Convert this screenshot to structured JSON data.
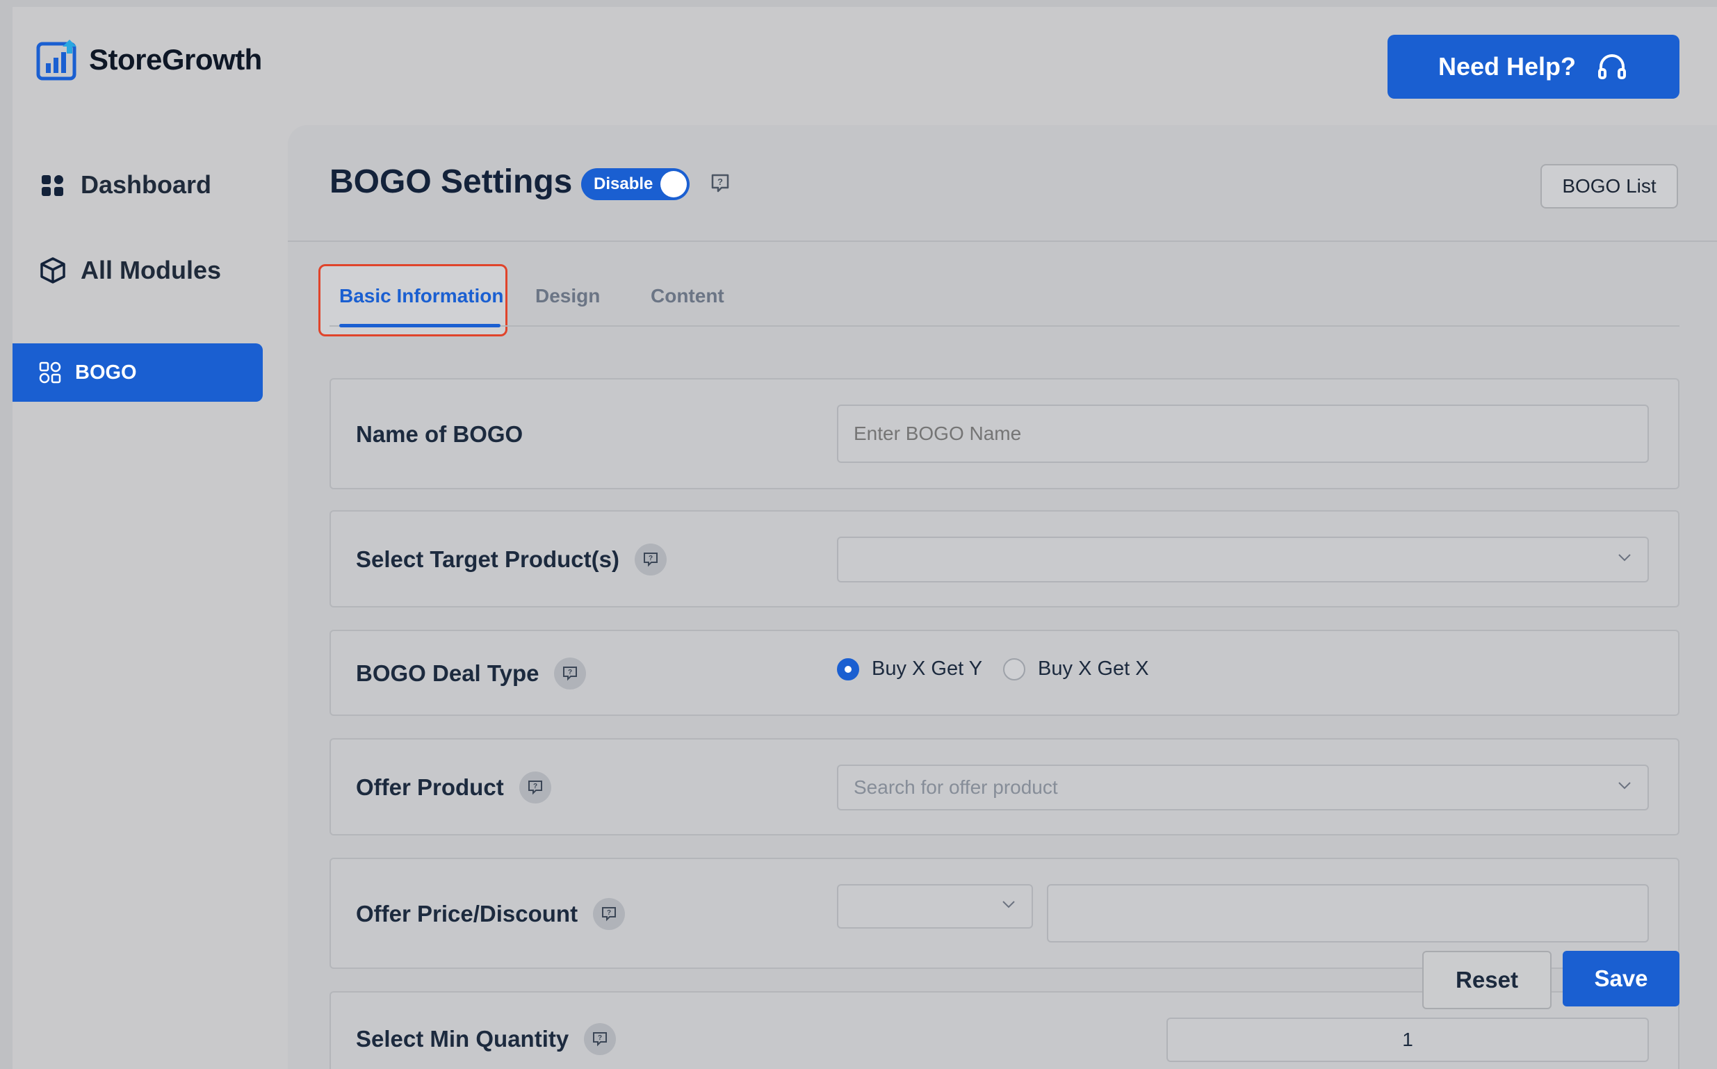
{
  "brand": {
    "name": "StoreGrowth",
    "logo_icon": "bar-chart-logo-icon"
  },
  "header": {
    "help_label": "Need Help?",
    "help_icon": "headset-icon"
  },
  "sidebar": {
    "items": [
      {
        "label": "Dashboard",
        "icon": "grid-icon"
      },
      {
        "label": "All Modules",
        "icon": "cube-icon"
      },
      {
        "label": "BOGO",
        "icon": "modules-icon",
        "active": true
      }
    ]
  },
  "page": {
    "title": "BOGO Settings",
    "toggle_label": "Disable",
    "list_button": "BOGO List"
  },
  "tabs": [
    {
      "label": "Basic Information",
      "active": true
    },
    {
      "label": "Design"
    },
    {
      "label": "Content"
    }
  ],
  "form": {
    "name": {
      "label": "Name of BOGO",
      "placeholder": "Enter BOGO Name",
      "value": ""
    },
    "target": {
      "label": "Select Target Product(s)",
      "value": ""
    },
    "deal_type": {
      "label": "BOGO Deal Type",
      "options": [
        "Buy X Get Y",
        "Buy X Get X"
      ],
      "selected": "Buy X Get Y"
    },
    "offer_product": {
      "label": "Offer Product",
      "placeholder": "Search for offer product"
    },
    "offer_price": {
      "label": "Offer Price/Discount",
      "type_value": "",
      "amount_value": ""
    },
    "min_qty": {
      "label": "Select Min Quantity",
      "value": "1"
    }
  },
  "actions": {
    "reset": "Reset",
    "save": "Save"
  },
  "colors": {
    "accent": "#1a5fd1",
    "highlight": "#e0442b",
    "background": "#c9c9cb"
  }
}
